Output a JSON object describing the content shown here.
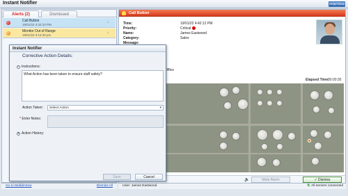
{
  "window": {
    "title": "Instant Notifier",
    "help_label": "Help/About"
  },
  "tabs": {
    "alerts": "Alerts (2)",
    "dismissed": "Dismissed"
  },
  "alerts": [
    {
      "name": "Call Button",
      "time": "19/01/22 4:42:10 PM",
      "color": "#c40000"
    },
    {
      "name": "Monitor Out of Range",
      "time": "19/01/22 3:12:40 pm",
      "color": "#e07000"
    }
  ],
  "left_links": {
    "mobile": "Go to MobileView",
    "dismiss_all": "Dismiss All"
  },
  "detail": {
    "header": "Call Button",
    "labels": {
      "time": "Time:",
      "priority": "Priority:",
      "name": "Name:",
      "category": "Category:",
      "message": "Message:"
    },
    "values": {
      "time": "19/01/22 4:42:12 PM",
      "priority": "Critical",
      "name": "James Eastwood",
      "category": "Sales",
      "message": ""
    },
    "location": "Office",
    "elapsed_label": "Elapsed Time:",
    "elapsed_value": "00:00:30"
  },
  "actions": {
    "mute": "Mute Alarm",
    "dismiss": "Dismiss"
  },
  "status": {
    "user": "User: James Eastwood",
    "connection": "All servers connected"
  },
  "dialog": {
    "title": "Instant Notifier",
    "subtitle": "Corrective Action Details:",
    "instructions_label": "Instructions:",
    "instructions_text": "What Action has been taken to ensure staff safety?",
    "action_taken_label": "Action Taken:",
    "action_taken_value": "Select Action",
    "notes_label": "Enter Notes:",
    "history_label": "Action History:",
    "save": "Save",
    "cancel": "Cancel"
  },
  "colors": {
    "header_accent": "#d63b1d",
    "critical": "#dd0000",
    "connected": "#2a9d2a"
  }
}
